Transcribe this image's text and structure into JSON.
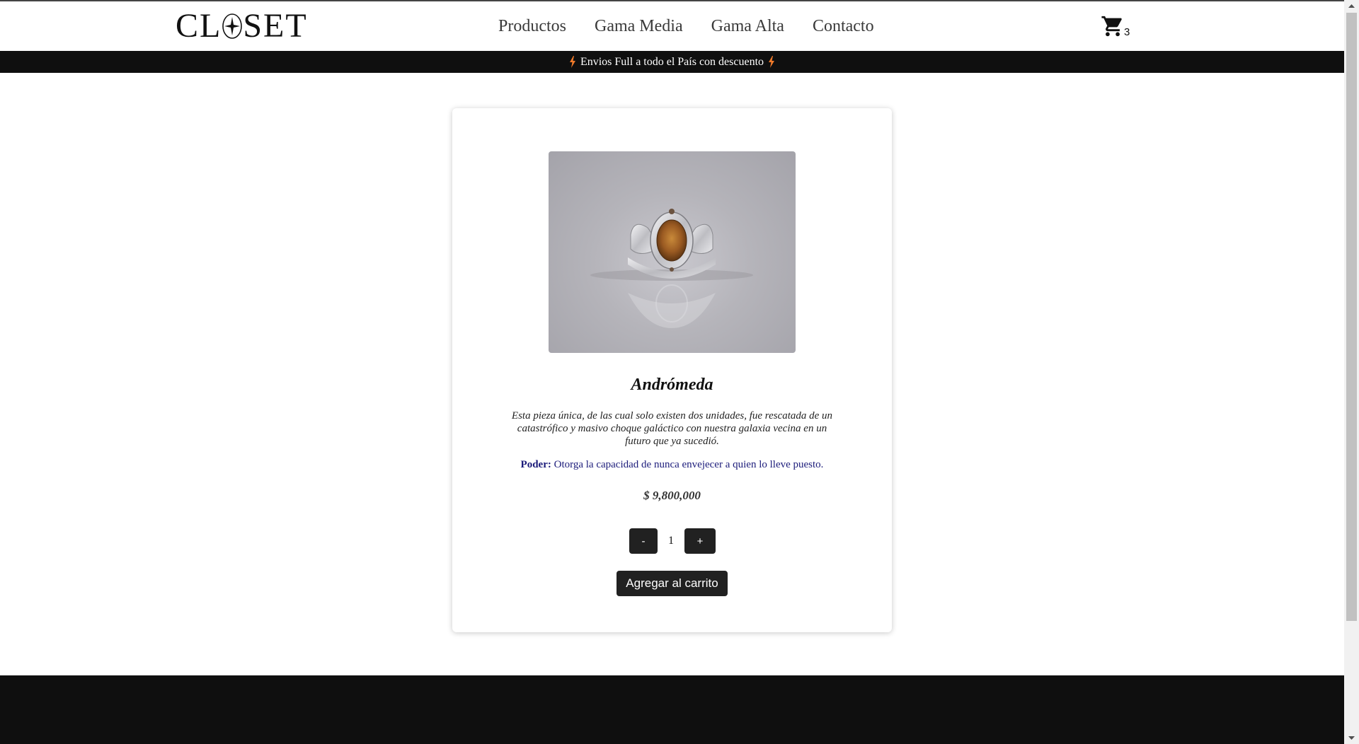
{
  "brand": {
    "logo_text": "CL",
    "logo_text_after": "SET"
  },
  "nav": {
    "items": [
      "Productos",
      "Gama Media",
      "Gama Alta",
      "Contacto"
    ]
  },
  "cart": {
    "icon": "shopping-cart-icon",
    "count": "3"
  },
  "promo": {
    "text": "Envios Full a todo el País con descuento",
    "icon": "lightning-bolt-icon",
    "icon_color": "#f07a2a"
  },
  "product": {
    "name": "Andrómeda",
    "description": "Esta pieza única, de las cual solo existen dos unidades, fue rescatada de un catastrófico y masivo choque galáctico con nuestra galaxia vecina en un futuro que ya sucedió.",
    "power_label": "Poder:",
    "power_text": "Otorga la capacidad de nunca envejecer a quien lo lleve puesto.",
    "price": "$ 9,800,000",
    "quantity": "1",
    "minus_label": "-",
    "plus_label": "+",
    "add_to_cart_label": "Agregar al carrito"
  },
  "colors": {
    "header_bg": "#ffffff",
    "promo_bg": "#0f0f0f",
    "button_bg": "#212121",
    "power_text": "#1b1b7a",
    "footer_bg": "#0f0f0f"
  }
}
